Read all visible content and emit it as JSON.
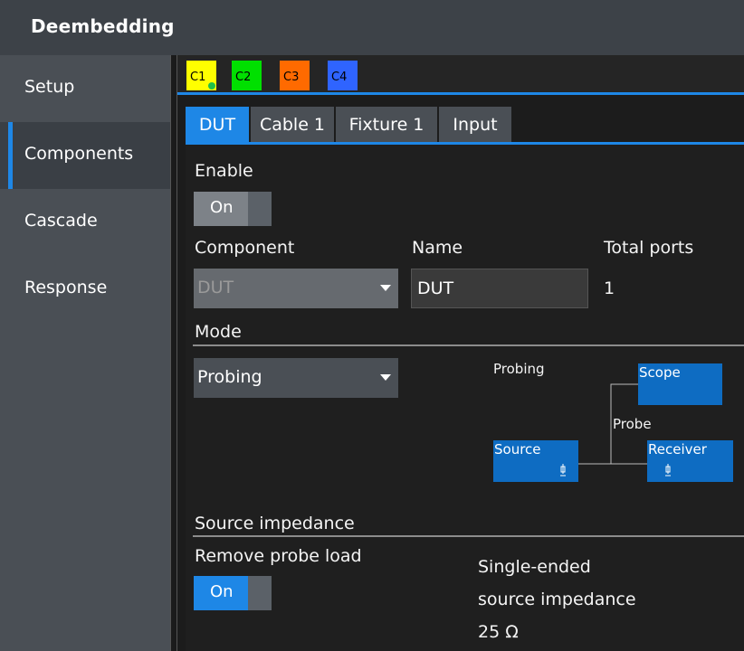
{
  "window": {
    "title": "Deembedding"
  },
  "sidebar": {
    "items": [
      {
        "label": "Setup",
        "active": false
      },
      {
        "label": "Components",
        "active": true
      },
      {
        "label": "Cascade",
        "active": false
      },
      {
        "label": "Response",
        "active": false
      }
    ]
  },
  "channels": [
    {
      "label": "C1",
      "color": "#ffff00",
      "text_color": "#000000",
      "selected": true
    },
    {
      "label": "C2",
      "color": "#00e000",
      "text_color": "#000000"
    },
    {
      "label": "C3",
      "color": "#ff6a00",
      "text_color": "#000000"
    },
    {
      "label": "C4",
      "color": "#2f64ff",
      "text_color": "#000000"
    }
  ],
  "component_tabs": [
    {
      "label": "DUT",
      "active": true
    },
    {
      "label": "Cable 1"
    },
    {
      "label": "Fixture 1"
    },
    {
      "label": "Input"
    }
  ],
  "enable": {
    "label": "Enable",
    "value": "On"
  },
  "component": {
    "label": "Component",
    "value": "DUT",
    "disabled": true
  },
  "name": {
    "label": "Name",
    "value": "DUT"
  },
  "total_ports": {
    "label": "Total ports",
    "value": "1"
  },
  "mode": {
    "section": "Mode",
    "value": "Probing"
  },
  "diagram": {
    "title": "Probing",
    "scope": "Scope",
    "probe": "Probe",
    "source": "Source",
    "receiver": "Receiver",
    "block_color": "#0e6cc2"
  },
  "source_impedance": {
    "section": "Source impedance",
    "remove_probe_load_label": "Remove probe load",
    "remove_probe_load_value": "On",
    "single_ended_line1": "Single-ended",
    "single_ended_line2": "source impedance",
    "impedance_value": "25 Ω"
  },
  "colors": {
    "accent": "#1e87e6",
    "panel": "#1f1f1f",
    "sidebar": "#4a4f55"
  }
}
